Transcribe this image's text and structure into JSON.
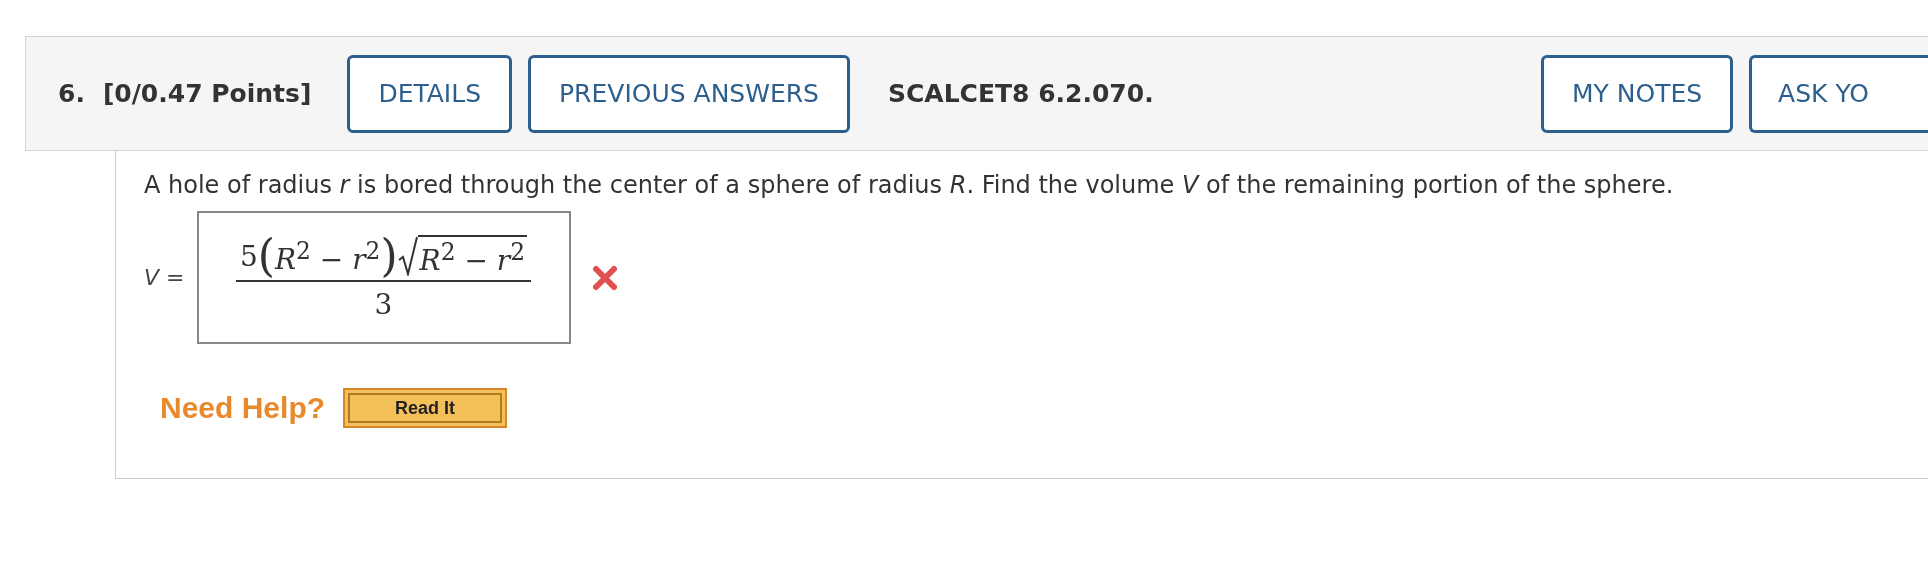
{
  "question": {
    "number": "6.",
    "points": "[0/0.47 Points]",
    "buttons": [
      {
        "label": "DETAILS"
      },
      {
        "label": "PREVIOUS ANSWERS"
      }
    ],
    "source": "SCALCET8 6.2.070.",
    "right_buttons": [
      {
        "label": "MY NOTES",
        "cut": false
      },
      {
        "label": "ASK YO",
        "cut": true
      }
    ]
  },
  "prompt": "A hole of radius *r* is bored through the center of a sphere of radius *R*. Find the volume *V* of the remaining portion of the sphere.",
  "answer": {
    "label": "*V* =",
    "coefficient": "5",
    "open": "(",
    "factor": "*R*$^{2}$ − *r*$^{2}$",
    "close": ")",
    "radicand": "*R*$^{2}$ − *r*$^{2}$",
    "denominator": "3",
    "correct": false
  },
  "help": {
    "label": "Need Help?",
    "button": "Read It"
  }
}
